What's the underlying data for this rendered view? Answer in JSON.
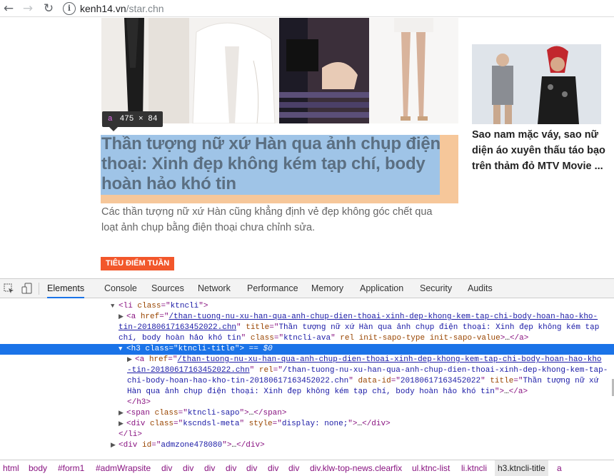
{
  "browser": {
    "back_icon": "arrow-left-icon",
    "forward_icon": "arrow-right-icon",
    "reload_icon": "reload-icon",
    "url_host": "kenh14.vn",
    "url_path": "/star.chn"
  },
  "page": {
    "tooltip_tag": "a",
    "tooltip_size": "475 × 84",
    "headline": "Thần tượng nữ xứ Hàn qua ảnh chụp điện thoại: Xinh đẹp không kém tạp chí, body hoàn hảo khó tin",
    "sapo": "Các thần tượng nữ xứ Hàn cũng khẳng định vẻ đẹp không góc chết qua loạt ảnh chụp bằng điện thoại chưa chỉnh sửa.",
    "badge": "TIÊU ĐIỂM TUẦN",
    "side_title": "Sao nam mặc váy, sao nữ diện áo xuyên thấu táo bạo trên thảm đỏ MTV Movie ..."
  },
  "devtools": {
    "tabs": [
      "Elements",
      "Console",
      "Sources",
      "Network",
      "Performance",
      "Memory",
      "Application",
      "Security",
      "Audits"
    ],
    "active_tab": "Elements",
    "dom": {
      "l1_tag": "li",
      "l1_attr": "class",
      "l1_val": "ktncli",
      "l2_tag": "a",
      "l2_href_a": "/than-tuong-nu-xu-han-qua-anh-chup-dien-thoai-xinh-dep-khong-kem-tap-chi-body-hoan-hao-kho-",
      "l2_href_b": "tin-20180617163452022.chn",
      "l2_title_a": "Thần tượng nữ xứ Hàn qua ảnh chụp điện thoại: Xinh đẹp không kém tạp",
      "l2_title_b": "chí, body hoàn hảo khó tin",
      "l2_class": "ktncli-ava",
      "l2_rest": "rel init-sapo-type init-sapo-value",
      "l3_tag": "h3",
      "l3_class": "ktncli-title",
      "l3_dollar": "== $0",
      "l4_href_a": "/than-tuong-nu-xu-han-qua-anh-chup-dien-thoai-xinh-dep-khong-kem-tap-chi-body-hoan-hao-kho",
      "l4_href_b": "-tin-20180617163452022.chn",
      "l4_rel_a": "/than-tuong-nu-xu-han-qua-anh-chup-dien-thoai-xinh-dep-khong-kem-tap-",
      "l4_rel_b": "chi-body-hoan-hao-kho-tin-20180617163452022.chn",
      "l4_dataid": "20180617163452022",
      "l4_title_a": "Thần tượng nữ xứ",
      "l4_title_b": "Hàn qua ảnh chụp điện thoại: Xinh đẹp không kém tạp chí, body hoàn hảo khó tin",
      "l5_close": "</h3>",
      "l6_class": "ktncli-sapo",
      "l7_class": "kscndsl-meta",
      "l7_style": "display: none;",
      "l8_close": "</li>",
      "l9_id": "admzone478080"
    },
    "breadcrumbs": [
      "html",
      "body",
      "#form1",
      "#admWrapsite",
      "div",
      "div",
      "div",
      "div",
      "div",
      "div",
      "div",
      "div.klw-top-news.clearfix",
      "ul.ktnc-list",
      "li.ktncli",
      "h3.ktncli-title",
      "a"
    ],
    "active_crumb": "h3.ktncli-title"
  }
}
